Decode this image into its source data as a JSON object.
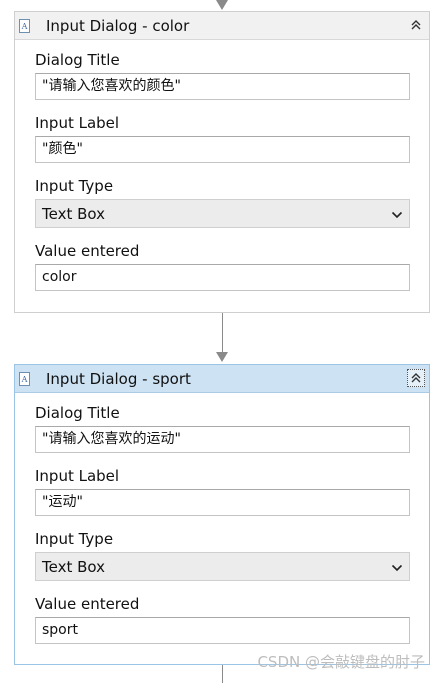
{
  "activities": [
    {
      "title": "Input Dialog - color",
      "icon": "input-dialog-icon",
      "collapse_icon": "double-chevron-up-icon",
      "selected": false,
      "fields": {
        "dialog_title": {
          "label": "Dialog Title",
          "value": "\"请输入您喜欢的颜色\""
        },
        "input_label": {
          "label": "Input Label",
          "value": "\"颜色\""
        },
        "input_type": {
          "label": "Input Type",
          "value": "Text Box"
        },
        "value_entered": {
          "label": "Value entered",
          "value": "color"
        }
      }
    },
    {
      "title": "Input Dialog - sport",
      "icon": "input-dialog-icon",
      "collapse_icon": "double-chevron-up-icon",
      "selected": true,
      "fields": {
        "dialog_title": {
          "label": "Dialog Title",
          "value": "\"请输入您喜欢的运动\""
        },
        "input_label": {
          "label": "Input Label",
          "value": "\"运动\""
        },
        "input_type": {
          "label": "Input Type",
          "value": "Text Box"
        },
        "value_entered": {
          "label": "Value entered",
          "value": "sport"
        }
      }
    }
  ],
  "watermark": "CSDN @会敲键盘的肘子",
  "colors": {
    "selected_header": "#cde2f3",
    "header": "#f1f1f1",
    "connector": "#8a8a8a"
  }
}
